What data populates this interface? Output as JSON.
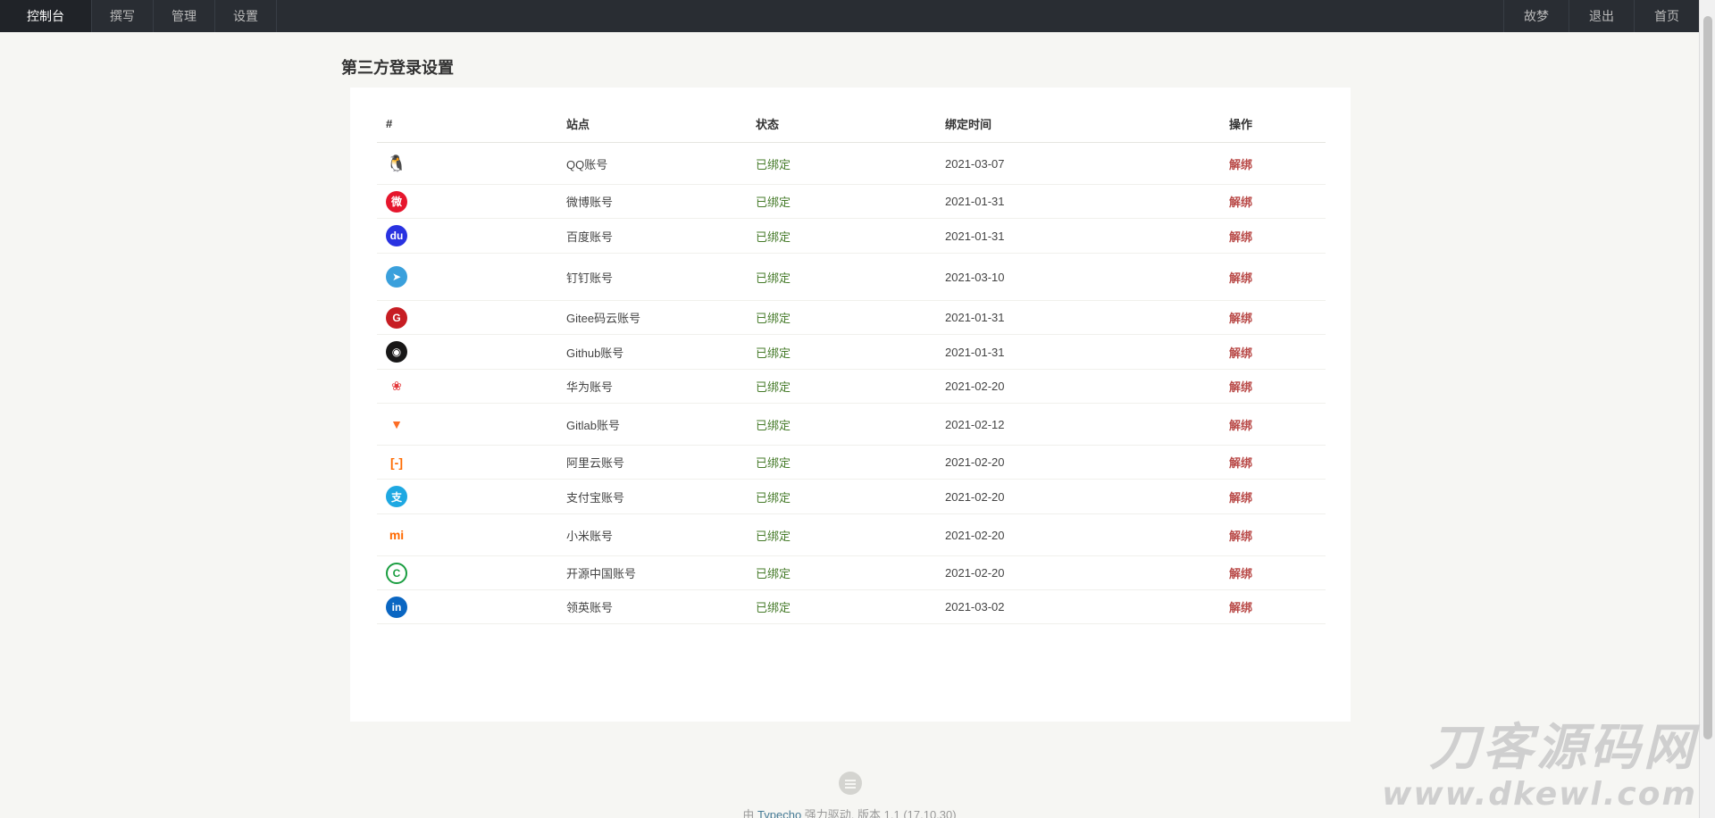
{
  "nav": {
    "left": [
      {
        "label": "控制台",
        "active": true
      },
      {
        "label": "撰写"
      },
      {
        "label": "管理"
      },
      {
        "label": "设置"
      }
    ],
    "right": [
      {
        "label": "故梦"
      },
      {
        "label": "退出"
      },
      {
        "label": "首页"
      }
    ]
  },
  "page_title": "第三方登录设置",
  "table": {
    "headers": {
      "icon": "#",
      "site": "站点",
      "status": "状态",
      "time": "绑定时间",
      "op": "操作"
    },
    "rows": [
      {
        "icon": "qq-icon",
        "site": "QQ账号",
        "status": "已绑定",
        "time": "2021-03-07",
        "op": "解绑",
        "color": "#111111"
      },
      {
        "icon": "weibo-icon",
        "site": "微博账号",
        "status": "已绑定",
        "time": "2021-01-31",
        "op": "解绑",
        "color": "#e6162d"
      },
      {
        "icon": "baidu-icon",
        "site": "百度账号",
        "status": "已绑定",
        "time": "2021-01-31",
        "op": "解绑",
        "color": "#2932e1"
      },
      {
        "icon": "dingtalk-icon",
        "site": "钉钉账号",
        "status": "已绑定",
        "time": "2021-03-10",
        "op": "解绑",
        "color": "#3aa0dc"
      },
      {
        "icon": "gitee-icon",
        "site": "Gitee码云账号",
        "status": "已绑定",
        "time": "2021-01-31",
        "op": "解绑",
        "color": "#c71d23"
      },
      {
        "icon": "github-icon",
        "site": "Github账号",
        "status": "已绑定",
        "time": "2021-01-31",
        "op": "解绑",
        "color": "#181717"
      },
      {
        "icon": "huawei-icon",
        "site": "华为账号",
        "status": "已绑定",
        "time": "2021-02-20",
        "op": "解绑",
        "color": "#e4393c"
      },
      {
        "icon": "gitlab-icon",
        "site": "Gitlab账号",
        "status": "已绑定",
        "time": "2021-02-12",
        "op": "解绑",
        "color": "#fc6d26"
      },
      {
        "icon": "aliyun-icon",
        "site": "阿里云账号",
        "status": "已绑定",
        "time": "2021-02-20",
        "op": "解绑",
        "color": "#ff6a00"
      },
      {
        "icon": "alipay-icon",
        "site": "支付宝账号",
        "status": "已绑定",
        "time": "2021-02-20",
        "op": "解绑",
        "color": "#1ea8e2"
      },
      {
        "icon": "xiaomi-icon",
        "site": "小米账号",
        "status": "已绑定",
        "time": "2021-02-20",
        "op": "解绑",
        "color": "#ff6900"
      },
      {
        "icon": "oschina-icon",
        "site": "开源中国账号",
        "status": "已绑定",
        "time": "2021-02-20",
        "op": "解绑",
        "color": "#1b9e41"
      },
      {
        "icon": "linkedin-icon",
        "site": "领英账号",
        "status": "已绑定",
        "time": "2021-03-02",
        "op": "解绑",
        "color": "#0a66c2"
      }
    ]
  },
  "footer": {
    "prefix": "由 ",
    "link": "Typecho",
    "suffix": " 强力驱动, 版本 1.1 (17.10.30)"
  },
  "watermark": {
    "line1": "刀客源码网",
    "line2": "www.dkewl.com"
  }
}
